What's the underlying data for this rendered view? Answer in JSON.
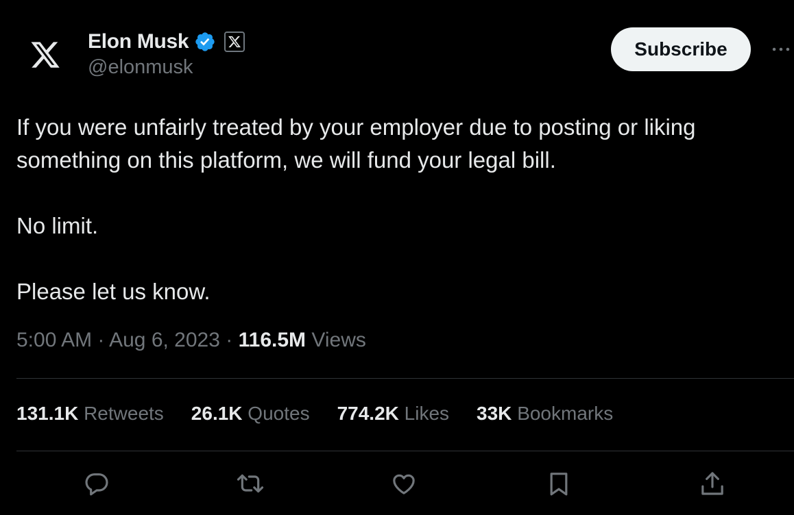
{
  "author": {
    "display_name": "Elon Musk",
    "handle": "@elonmusk",
    "avatar_icon": "x-logo-icon",
    "verified_color": "#1d9bf0",
    "affiliation_icon": "x-logo-icon"
  },
  "header": {
    "subscribe_label": "Subscribe",
    "more_icon": "more-dots-icon"
  },
  "tweet": {
    "lines": [
      "If you were unfairly treated by your employer due to posting or liking",
      "something on this platform, we will fund your legal bill.",
      "No limit.",
      "Please let us know."
    ]
  },
  "meta": {
    "time": "5:00 AM",
    "separator": "·",
    "date": "Aug 6, 2023",
    "views_count": "116.5M",
    "views_label": "Views"
  },
  "stats": [
    {
      "count": "131.1K",
      "label": "Retweets"
    },
    {
      "count": "26.1K",
      "label": "Quotes"
    },
    {
      "count": "774.2K",
      "label": "Likes"
    },
    {
      "count": "33K",
      "label": "Bookmarks"
    }
  ],
  "actions": [
    {
      "icon": "reply-icon"
    },
    {
      "icon": "retweet-icon"
    },
    {
      "icon": "like-icon"
    },
    {
      "icon": "bookmark-icon"
    },
    {
      "icon": "share-icon"
    }
  ],
  "colors": {
    "background": "#000000",
    "primary_text": "#e7e9ea",
    "secondary_text": "#71767b",
    "divider": "#2f3336",
    "button_bg": "#eff3f4"
  }
}
